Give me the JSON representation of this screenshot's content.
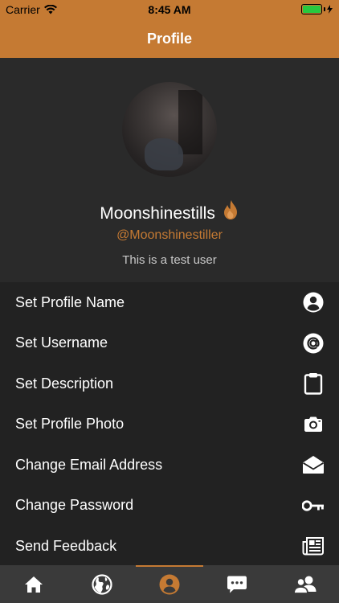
{
  "status_bar": {
    "carrier": "Carrier",
    "time": "8:45 AM"
  },
  "nav": {
    "title": "Profile"
  },
  "profile": {
    "name": "Moonshinestills",
    "username": "@Moonshinestiller",
    "description": "This is a test user"
  },
  "menu": [
    {
      "label": "Set Profile Name",
      "icon": "user-circle-icon"
    },
    {
      "label": "Set Username",
      "icon": "at-sign-icon"
    },
    {
      "label": "Set Description",
      "icon": "clipboard-icon"
    },
    {
      "label": "Set Profile Photo",
      "icon": "camera-icon"
    },
    {
      "label": "Change Email Address",
      "icon": "envelope-open-icon"
    },
    {
      "label": "Change Password",
      "icon": "key-icon"
    },
    {
      "label": "Send Feedback",
      "icon": "newspaper-icon"
    }
  ],
  "tabs": [
    {
      "icon": "home-icon",
      "active": false
    },
    {
      "icon": "globe-icon",
      "active": false
    },
    {
      "icon": "profile-icon",
      "active": true
    },
    {
      "icon": "chat-icon",
      "active": false
    },
    {
      "icon": "users-icon",
      "active": false
    }
  ],
  "colors": {
    "accent": "#c57a33",
    "background": "#222222",
    "header_background": "#2a2a2a",
    "tab_bar": "#3a3a3a",
    "battery": "#27c93f"
  }
}
